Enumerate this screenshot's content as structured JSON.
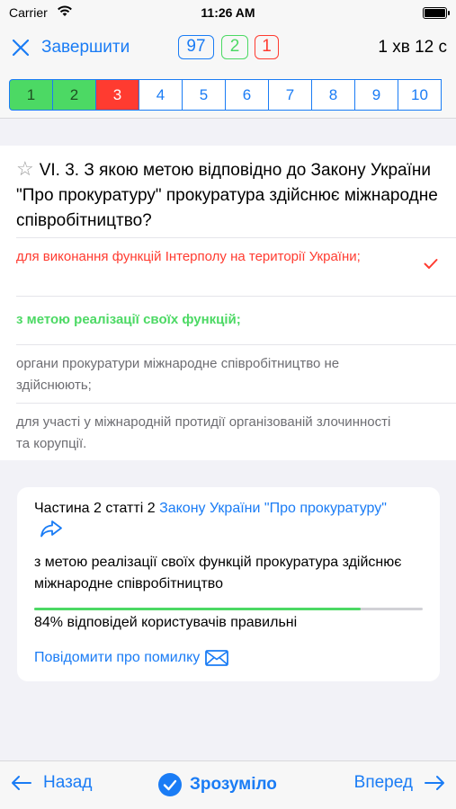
{
  "status_bar": {
    "carrier": "Carrier",
    "time": "11:26 AM"
  },
  "nav": {
    "finish_label": "Завершити",
    "total_count": "97",
    "correct_count": "2",
    "wrong_count": "1",
    "timer": "1 хв 12 с"
  },
  "question_nav": [
    {
      "label": "1",
      "state": "correct"
    },
    {
      "label": "2",
      "state": "correct"
    },
    {
      "label": "3",
      "state": "wrong"
    },
    {
      "label": "4",
      "state": "none"
    },
    {
      "label": "5",
      "state": "none"
    },
    {
      "label": "6",
      "state": "none"
    },
    {
      "label": "7",
      "state": "none"
    },
    {
      "label": "8",
      "state": "none"
    },
    {
      "label": "9",
      "state": "none"
    },
    {
      "label": "10",
      "state": "none"
    }
  ],
  "question": {
    "star_icon": "☆",
    "text": "VI. 3. З якою метою відповідно до Закону України \"Про прокуратуру\" прокуратура здійснює міжнародне співробітництво?",
    "answers": [
      {
        "text": "для виконання функцій Інтерполу на території України;",
        "state": "selected-wrong"
      },
      {
        "text": "з метою реалізації своїх функцій;",
        "state": "correct"
      },
      {
        "text": "органи прокуратури міжнародне співробітництво не здійснюють;",
        "state": "neutral"
      },
      {
        "text": "для участі у міжнародній протидії організованій злочинності та корупції.",
        "state": "neutral"
      }
    ]
  },
  "explanation": {
    "source_prefix": "Частина 2 статті 2",
    "source_link": "Закону України \"Про прокуратуру\"",
    "text": "з метою реалізації своїх функцій прокуратура здійснює міжнародне співробітництво",
    "correct_percent": 84,
    "stats_text": "84% відповідей користувачів правильні",
    "report_label": "Повідомити про помилку"
  },
  "bottom": {
    "back_label": "Назад",
    "understood_label": "Зрозуміло",
    "forward_label": "Вперед"
  },
  "colors": {
    "accent": "#1a7cf5",
    "correct": "#4cd964",
    "wrong": "#ff3b30"
  }
}
